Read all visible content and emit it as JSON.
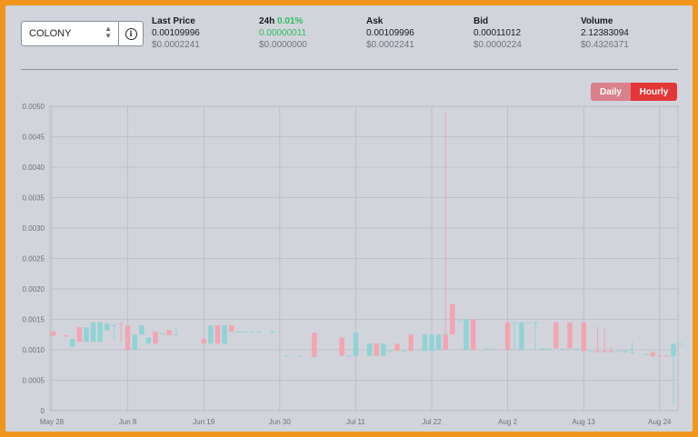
{
  "selector": {
    "value": "COLONY"
  },
  "stats": {
    "last_price": {
      "label": "Last Price",
      "value": "0.00109996",
      "usd": "$0.0002241"
    },
    "change_24h": {
      "label": "24h",
      "pct": "0.01%",
      "value": "0.00000011",
      "usd": "$0.0000000"
    },
    "ask": {
      "label": "Ask",
      "value": "0.00109996",
      "usd": "$0.0002241"
    },
    "bid": {
      "label": "Bid",
      "value": "0.00011012",
      "usd": "$0.0000224"
    },
    "volume": {
      "label": "Volume",
      "value": "2.12383094",
      "usd": "$0.4326371"
    }
  },
  "toggle": {
    "daily": "Daily",
    "hourly": "Hourly",
    "active": "Hourly"
  },
  "colors": {
    "up": "#8fd3d5",
    "down": "#f2a5b1",
    "accent": "#e33636",
    "frame": "#f0961d"
  },
  "chart_data": {
    "type": "candlestick",
    "ylim": [
      0,
      0.005
    ],
    "y_ticks": [
      "0",
      "0.0005",
      "0.0010",
      "0.0015",
      "0.0020",
      "0.0025",
      "0.0030",
      "0.0035",
      "0.0040",
      "0.0045",
      "0.0050"
    ],
    "x_ticks": [
      "May 28",
      "Jun 8",
      "Jun 19",
      "Jun 30",
      "Jul 11",
      "Jul 22",
      "Aug 2",
      "Aug 13",
      "Aug 24"
    ],
    "x_start": "May 28",
    "candles": [
      {
        "day": 0.2,
        "o": 0.0013,
        "c": 0.00123,
        "h": 0.0013,
        "l": 0.00123
      },
      {
        "day": 2.0,
        "o": 0.00124,
        "c": 0.00122,
        "h": 0.00124,
        "l": 0.00122
      },
      {
        "day": 3.0,
        "o": 0.00105,
        "c": 0.00118,
        "h": 0.00118,
        "l": 0.00105
      },
      {
        "day": 4.0,
        "o": 0.00137,
        "c": 0.00113,
        "h": 0.00137,
        "l": 0.00113
      },
      {
        "day": 5.0,
        "o": 0.00113,
        "c": 0.00137,
        "h": 0.00137,
        "l": 0.00113
      },
      {
        "day": 6.0,
        "o": 0.00113,
        "c": 0.00145,
        "h": 0.00145,
        "l": 0.00113
      },
      {
        "day": 7.0,
        "o": 0.00113,
        "c": 0.00145,
        "h": 0.00145,
        "l": 0.00113
      },
      {
        "day": 8.0,
        "o": 0.00132,
        "c": 0.00143,
        "h": 0.00143,
        "l": 0.00132
      },
      {
        "day": 9.0,
        "o": 0.0014,
        "c": 0.00141,
        "h": 0.00141,
        "l": 0.00118
      },
      {
        "day": 10.0,
        "o": 0.00143,
        "c": 0.00142,
        "h": 0.00146,
        "l": 0.00112
      },
      {
        "day": 11.0,
        "o": 0.0014,
        "c": 0.001,
        "h": 0.0014,
        "l": 0.001
      },
      {
        "day": 12.0,
        "o": 0.001,
        "c": 0.00125,
        "h": 0.00125,
        "l": 0.001
      },
      {
        "day": 13.0,
        "o": 0.00125,
        "c": 0.0014,
        "h": 0.0014,
        "l": 0.00125
      },
      {
        "day": 14.0,
        "o": 0.0011,
        "c": 0.0012,
        "h": 0.0012,
        "l": 0.0011
      },
      {
        "day": 15.0,
        "o": 0.0013,
        "c": 0.0011,
        "h": 0.0013,
        "l": 0.0011
      },
      {
        "day": 16.0,
        "o": 0.00127,
        "c": 0.00127,
        "h": 0.00127,
        "l": 0.00127
      },
      {
        "day": 17.0,
        "o": 0.00132,
        "c": 0.00124,
        "h": 0.00132,
        "l": 0.00124
      },
      {
        "day": 18.0,
        "o": 0.00124,
        "c": 0.00125,
        "h": 0.00138,
        "l": 0.00124
      },
      {
        "day": 22.0,
        "o": 0.00118,
        "c": 0.0011,
        "h": 0.00118,
        "l": 0.0011
      },
      {
        "day": 23.0,
        "o": 0.0011,
        "c": 0.0014,
        "h": 0.0014,
        "l": 0.0011
      },
      {
        "day": 24.0,
        "o": 0.0014,
        "c": 0.0011,
        "h": 0.0014,
        "l": 0.0011
      },
      {
        "day": 25.0,
        "o": 0.0011,
        "c": 0.0014,
        "h": 0.0014,
        "l": 0.0011
      },
      {
        "day": 26.0,
        "o": 0.0014,
        "c": 0.0013,
        "h": 0.0014,
        "l": 0.0013
      },
      {
        "day": 27.0,
        "o": 0.0013,
        "c": 0.0013,
        "h": 0.0013,
        "l": 0.0013
      },
      {
        "day": 28.0,
        "o": 0.0013,
        "c": 0.0013,
        "h": 0.0013,
        "l": 0.0013
      },
      {
        "day": 29.0,
        "o": 0.0013,
        "c": 0.0013,
        "h": 0.0013,
        "l": 0.0013
      },
      {
        "day": 30.0,
        "o": 0.0013,
        "c": 0.0013,
        "h": 0.0013,
        "l": 0.0013
      },
      {
        "day": 32.0,
        "o": 0.0013,
        "c": 0.0013,
        "h": 0.00133,
        "l": 0.00128
      },
      {
        "day": 34.0,
        "o": 0.0009,
        "c": 0.0009,
        "h": 0.0009,
        "l": 0.0009
      },
      {
        "day": 36.0,
        "o": 0.0009,
        "c": 0.0009,
        "h": 0.0009,
        "l": 0.0009
      },
      {
        "day": 38.0,
        "o": 0.00128,
        "c": 0.00088,
        "h": 0.00128,
        "l": 0.00088
      },
      {
        "day": 42.0,
        "o": 0.0012,
        "c": 0.0009,
        "h": 0.0012,
        "l": 0.0009
      },
      {
        "day": 43.0,
        "o": 0.0009,
        "c": 0.0009,
        "h": 0.0009,
        "l": 0.0009
      },
      {
        "day": 44.0,
        "o": 0.0009,
        "c": 0.00128,
        "h": 0.0013,
        "l": 0.0009
      },
      {
        "day": 46.0,
        "o": 0.0009,
        "c": 0.0011,
        "h": 0.0011,
        "l": 0.0009
      },
      {
        "day": 47.0,
        "o": 0.0011,
        "c": 0.0009,
        "h": 0.0011,
        "l": 0.0009
      },
      {
        "day": 48.0,
        "o": 0.0009,
        "c": 0.0011,
        "h": 0.0011,
        "l": 0.0009
      },
      {
        "day": 49.0,
        "o": 0.00098,
        "c": 0.00098,
        "h": 0.00098,
        "l": 0.00098
      },
      {
        "day": 50.0,
        "o": 0.0011,
        "c": 0.00098,
        "h": 0.0011,
        "l": 0.00098
      },
      {
        "day": 51.0,
        "o": 0.00098,
        "c": 0.00098,
        "h": 0.00098,
        "l": 0.00098
      },
      {
        "day": 52.0,
        "o": 0.00125,
        "c": 0.00098,
        "h": 0.00125,
        "l": 0.00098
      },
      {
        "day": 54.0,
        "o": 0.00098,
        "c": 0.00125,
        "h": 0.00125,
        "l": 0.00098
      },
      {
        "day": 55.0,
        "o": 0.00098,
        "c": 0.00125,
        "h": 0.00125,
        "l": 0.00098
      },
      {
        "day": 56.0,
        "o": 0.001,
        "c": 0.00125,
        "h": 0.00125,
        "l": 0.001
      },
      {
        "day": 57.0,
        "o": 0.00125,
        "c": 0.001,
        "h": 0.0049,
        "l": 0.001
      },
      {
        "day": 58.0,
        "o": 0.00175,
        "c": 0.00125,
        "h": 0.00175,
        "l": 0.00125
      },
      {
        "day": 59.0,
        "o": 0.00148,
        "c": 0.00148,
        "h": 0.00148,
        "l": 0.00148
      },
      {
        "day": 60.0,
        "o": 0.001,
        "c": 0.0015,
        "h": 0.0015,
        "l": 0.001
      },
      {
        "day": 61.0,
        "o": 0.0015,
        "c": 0.001,
        "h": 0.0015,
        "l": 0.001
      },
      {
        "day": 63.0,
        "o": 0.00102,
        "c": 0.00102,
        "h": 0.00102,
        "l": 0.00102
      },
      {
        "day": 66.0,
        "o": 0.00145,
        "c": 0.001,
        "h": 0.00145,
        "l": 0.001
      },
      {
        "day": 67.0,
        "o": 0.00145,
        "c": 0.00145,
        "h": 0.00145,
        "l": 0.001
      },
      {
        "day": 68.0,
        "o": 0.001,
        "c": 0.00145,
        "h": 0.00145,
        "l": 0.001
      },
      {
        "day": 69.0,
        "o": 0.00145,
        "c": 0.00145,
        "h": 0.00145,
        "l": 0.00145
      },
      {
        "day": 70.0,
        "o": 0.00145,
        "c": 0.00145,
        "h": 0.00145,
        "l": 0.001
      },
      {
        "day": 71.0,
        "o": 0.00102,
        "c": 0.00102,
        "h": 0.00102,
        "l": 0.00102
      },
      {
        "day": 72.0,
        "o": 0.00102,
        "c": 0.00102,
        "h": 0.00102,
        "l": 0.00102
      },
      {
        "day": 73.0,
        "o": 0.00145,
        "c": 0.00102,
        "h": 0.00145,
        "l": 0.00102
      },
      {
        "day": 74.0,
        "o": 0.00102,
        "c": 0.00102,
        "h": 0.00102,
        "l": 0.00102
      },
      {
        "day": 75.0,
        "o": 0.00145,
        "c": 0.00102,
        "h": 0.00145,
        "l": 0.00102
      },
      {
        "day": 76.0,
        "o": 0.001,
        "c": 0.00102,
        "h": 0.00102,
        "l": 0.001
      },
      {
        "day": 77.0,
        "o": 0.00145,
        "c": 0.00098,
        "h": 0.00145,
        "l": 0.00098
      },
      {
        "day": 78.0,
        "o": 0.00098,
        "c": 0.00098,
        "h": 0.00098,
        "l": 0.00098
      },
      {
        "day": 79.0,
        "o": 0.00098,
        "c": 0.00096,
        "h": 0.00138,
        "l": 0.00096
      },
      {
        "day": 80.0,
        "o": 0.00098,
        "c": 0.00096,
        "h": 0.00135,
        "l": 0.00096
      },
      {
        "day": 81.0,
        "o": 0.00098,
        "c": 0.00096,
        "h": 0.00105,
        "l": 0.00096
      },
      {
        "day": 82.0,
        "o": 0.00098,
        "c": 0.00098,
        "h": 0.00098,
        "l": 0.00098
      },
      {
        "day": 83.0,
        "o": 0.00096,
        "c": 0.00098,
        "h": 0.00098,
        "l": 0.00096
      },
      {
        "day": 84.0,
        "o": 0.00096,
        "c": 0.00096,
        "h": 0.00113,
        "l": 0.00096
      },
      {
        "day": 86.0,
        "o": 0.00093,
        "c": 0.00093,
        "h": 0.00093,
        "l": 0.00093
      },
      {
        "day": 87.0,
        "o": 0.00096,
        "c": 0.00089,
        "h": 0.00096,
        "l": 0.00089
      },
      {
        "day": 88.0,
        "o": 0.0009,
        "c": 0.00089,
        "h": 0.0009,
        "l": 0.00089
      },
      {
        "day": 89.0,
        "o": 0.0009,
        "c": 0.00089,
        "h": 0.0009,
        "l": 0.00089
      },
      {
        "day": 90.0,
        "o": 0.00089,
        "c": 0.0011,
        "h": 0.0011,
        "l": 0.0001
      },
      {
        "day": 91.0,
        "o": 0.0011,
        "c": 0.0011,
        "h": 0.0011,
        "l": 0.0011
      }
    ]
  }
}
